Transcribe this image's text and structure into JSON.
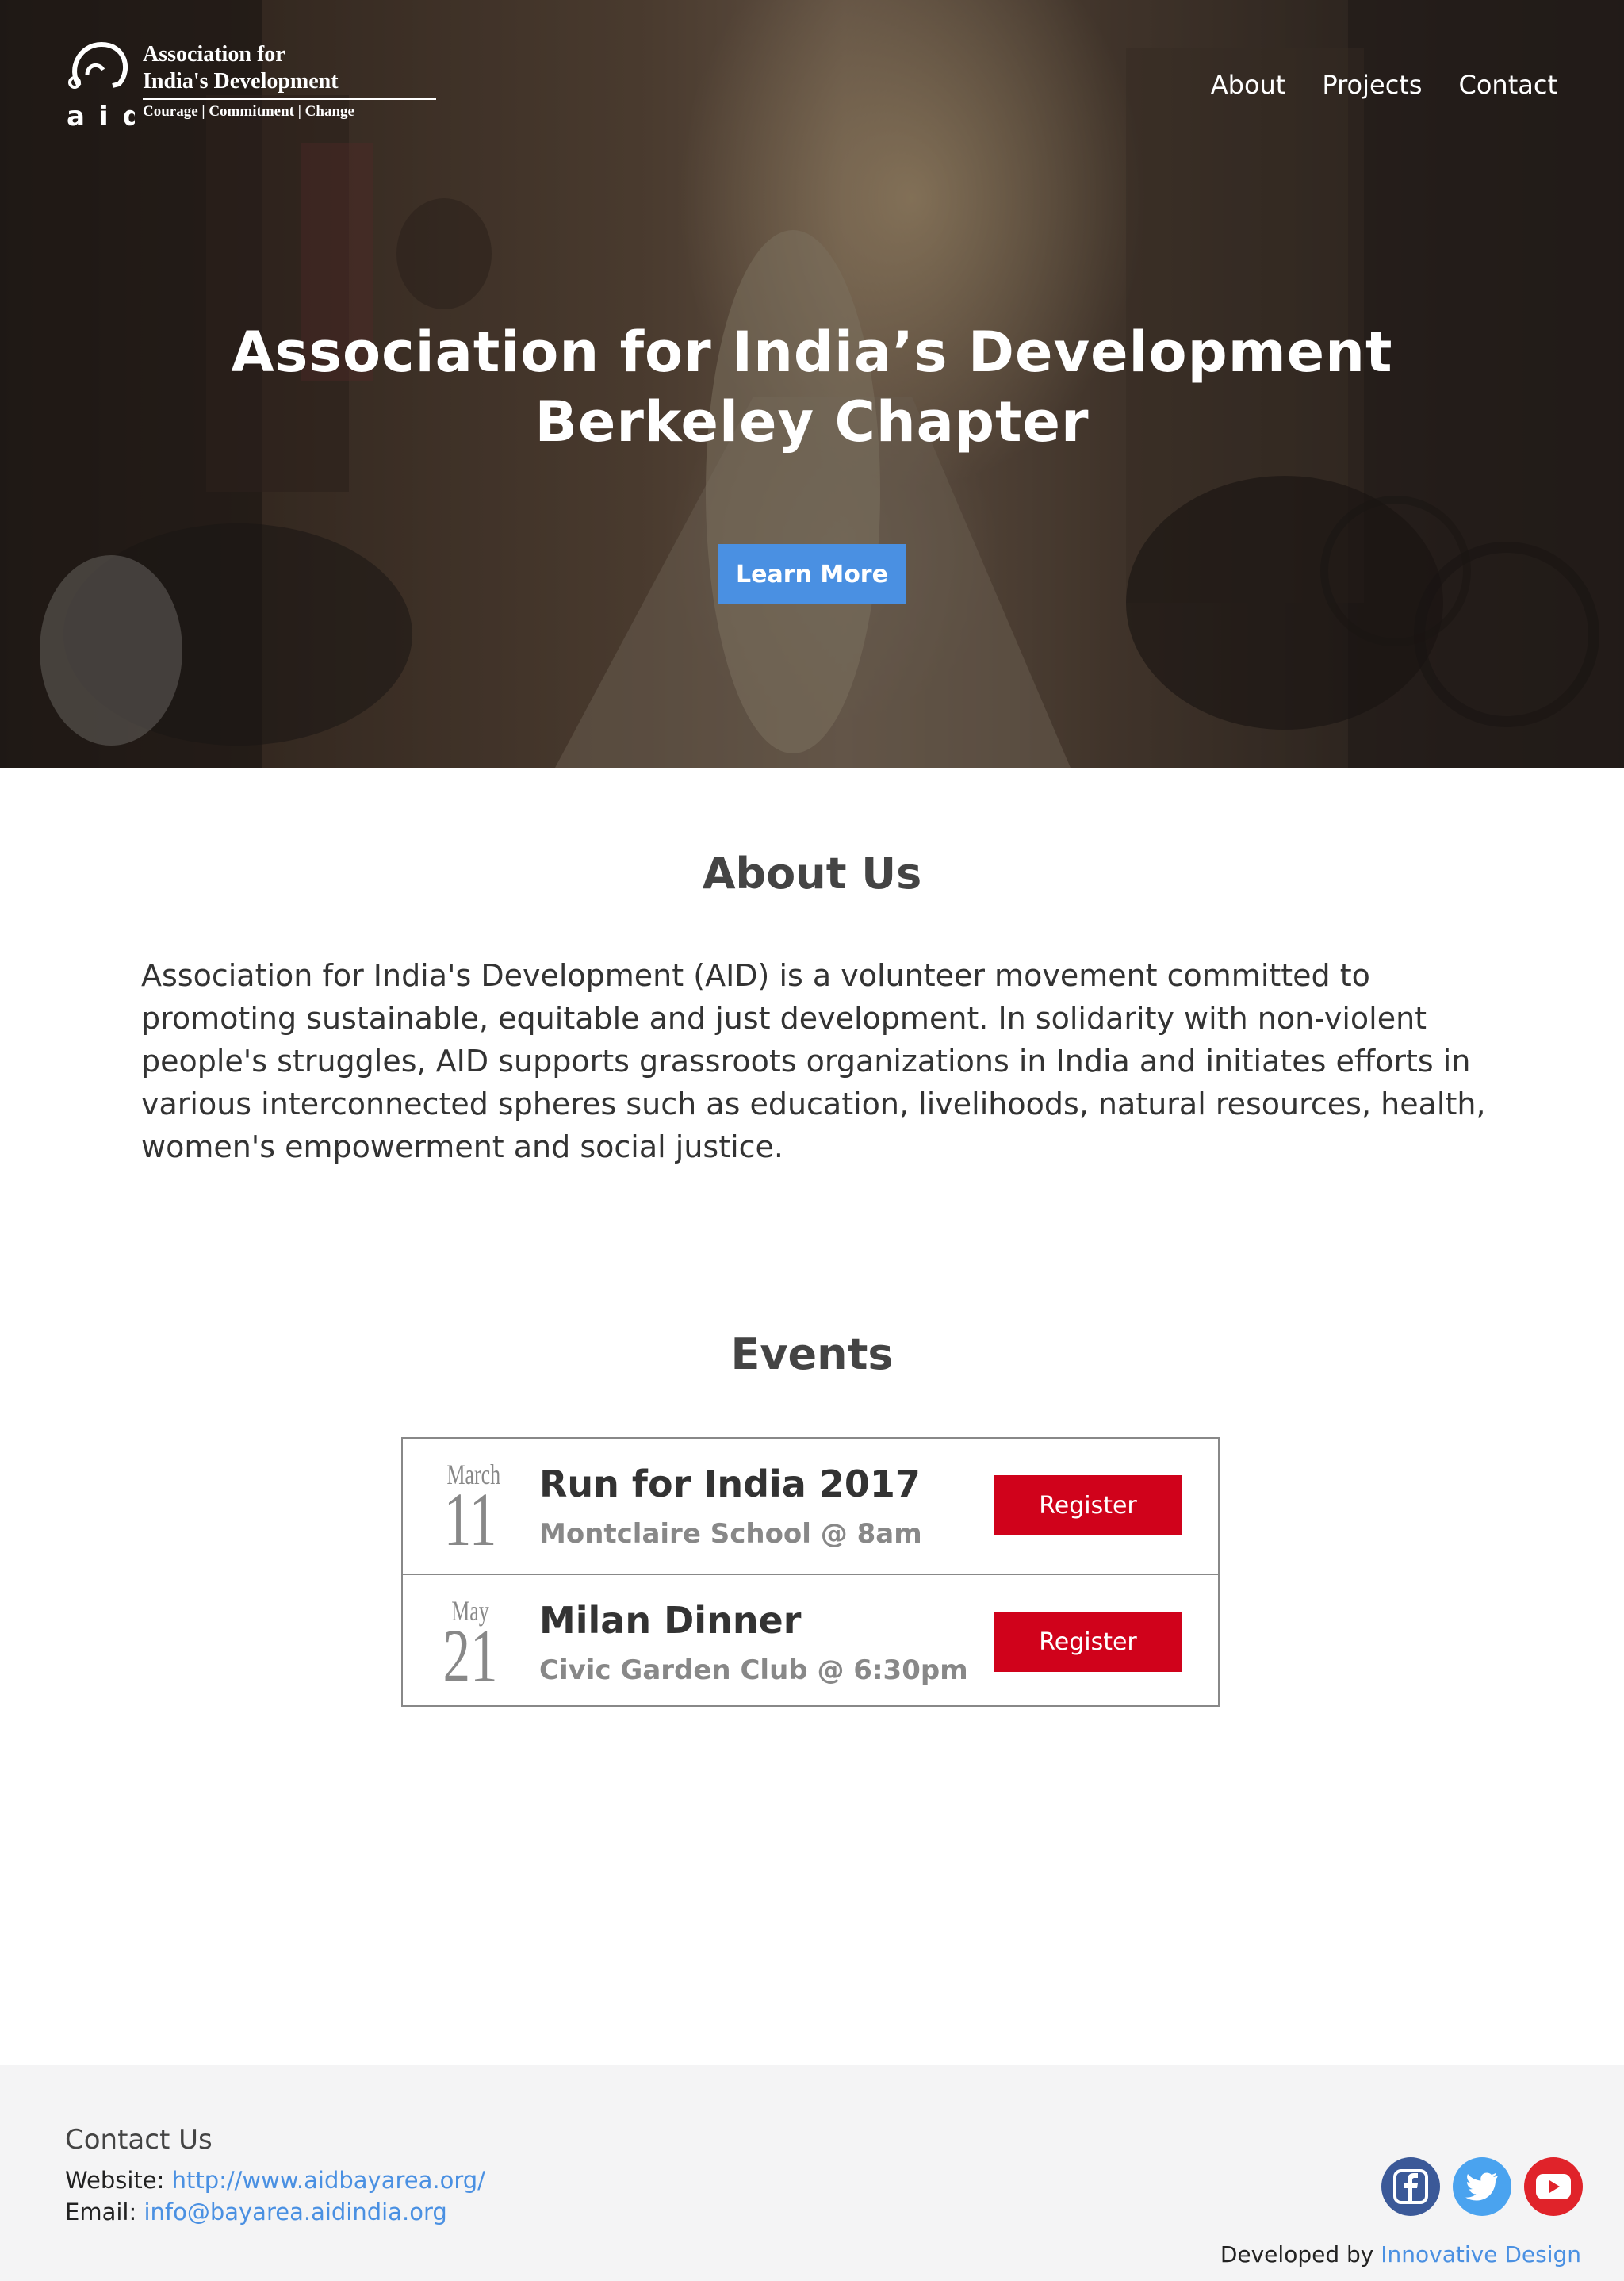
{
  "brand": {
    "name_line1": "Association for",
    "name_line2": "India's Development",
    "mark_text": "aid",
    "tagline": "Courage | Commitment | Change"
  },
  "nav": {
    "items": [
      {
        "label": "About"
      },
      {
        "label": "Projects"
      },
      {
        "label": "Contact"
      }
    ]
  },
  "hero": {
    "title_line1": "Association for India’s Development",
    "title_line2": "Berkeley Chapter",
    "cta_label": "Learn More"
  },
  "about": {
    "title": "About Us",
    "body": "Association for India's Development (AID) is a volunteer movement committed to promoting sustainable, equitable and just development. In solidarity with non-violent people's struggles, AID supports grassroots organizations in India and initiates efforts in various interconnected spheres such as education, livelihoods, natural resources, health, women's empowerment and social justice."
  },
  "events": {
    "title": "Events",
    "items": [
      {
        "month": "March",
        "day": "11",
        "name": "Run for India 2017",
        "where": "Montclaire School @ 8am",
        "button": "Register"
      },
      {
        "month": "May",
        "day": "21",
        "name": "Milan Dinner",
        "where": "Civic Garden Club @ 6:30pm",
        "button": "Register"
      }
    ]
  },
  "footer": {
    "title": "Contact Us",
    "website_label": "Website:",
    "website": "http://www.aidbayarea.org/",
    "email_label": "Email:",
    "email": "info@bayarea.aidindia.org",
    "developed_by": "Developed by",
    "developer": "Innovative Design",
    "social": [
      "facebook-icon",
      "twitter-icon",
      "youtube-icon"
    ]
  },
  "colors": {
    "accent_blue": "#4a90e2",
    "register_red": "#d0021b",
    "footer_bg": "#f4f4f5"
  }
}
